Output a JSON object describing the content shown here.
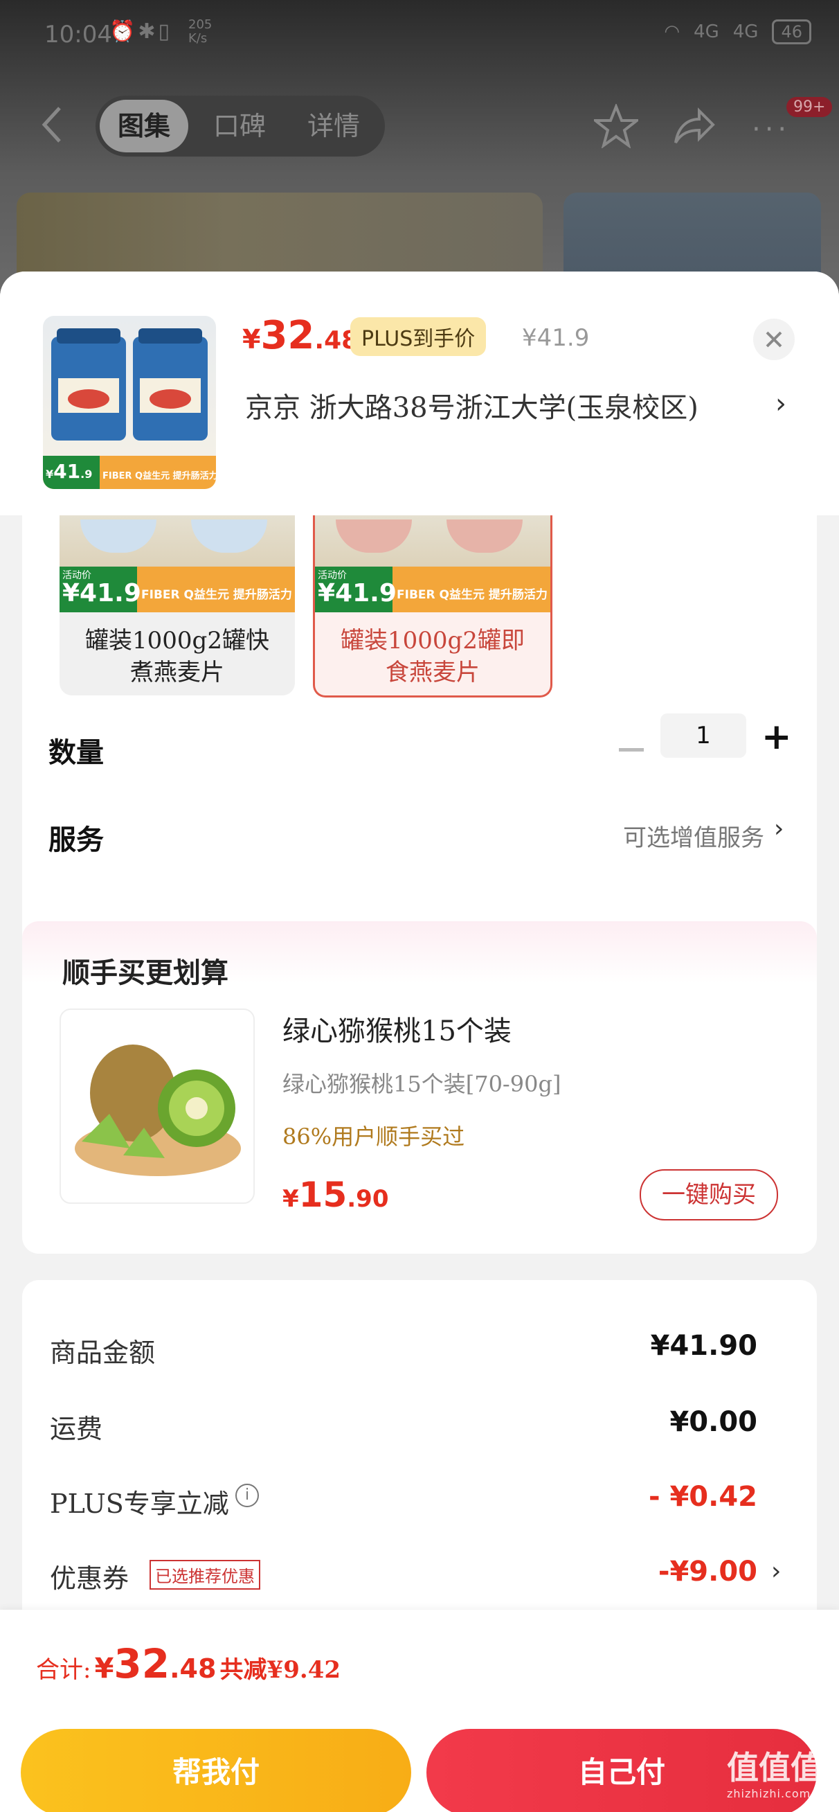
{
  "status_bar": {
    "time": "10:04",
    "speed": "205",
    "speed_unit": "K/s",
    "net1": "4G",
    "net2": "4G",
    "battery": "46"
  },
  "nav": {
    "tabs": [
      "图集",
      "口碑",
      "详情"
    ],
    "badge": "99+"
  },
  "product": {
    "price_yen": "¥",
    "price_int": "32",
    "price_dec": ".48",
    "plus_label": "PLUS到手价",
    "original_price": "¥41.9",
    "address": "京京   浙大路38号浙江大学(玉泉校区)",
    "thumb_price_yen": "¥",
    "thumb_price_int": "41",
    "thumb_price_dec": ".9",
    "thumb_strip_text": "FIBER Q益生元 提升肠活力"
  },
  "options": [
    {
      "label": "罐装1000g2罐快\n煮燕麦片",
      "badge": "活动价",
      "price": "¥41.9",
      "strip": "FIBER Q益生元 提升肠活力",
      "selected": false
    },
    {
      "label": "罐装1000g2罐即\n食燕麦片",
      "badge": "活动价",
      "price": "¥41.9",
      "strip": "FIBER Q益生元 提升肠活力",
      "selected": true
    }
  ],
  "quantity": {
    "label": "数量",
    "value": "1"
  },
  "service": {
    "label": "服务",
    "hint": "可选增值服务"
  },
  "bundle": {
    "title": "顺手买更划算",
    "name": "绿心猕猴桃15个装",
    "spec": "绿心猕猴桃15个装[70-90g]",
    "percent_text": "86%用户顺手买过",
    "price_yen": "¥",
    "price_int": "15",
    "price_dec": ".90",
    "button": "一键购买"
  },
  "summary": {
    "rows": [
      {
        "label": "商品金额",
        "value": "¥41.90"
      },
      {
        "label": "运费",
        "value": "¥0.00"
      },
      {
        "label": "PLUS专享立减",
        "value": "- ¥0.42"
      },
      {
        "label": "优惠券",
        "tag": "已选推荐优惠",
        "value": "-¥9.00"
      }
    ]
  },
  "footer": {
    "total_label": "合计:",
    "total_yen": "¥",
    "total_int": "32",
    "total_dec": ".48",
    "saving": "共减¥9.42",
    "btn_help": "帮我付",
    "btn_self": "自己付"
  },
  "watermark": {
    "big": "值值值",
    "small": "zhizhizhi.com"
  },
  "colors": {
    "accent_red": "#e62e1e",
    "button_yellow": "#fbc21e",
    "button_red": "#f23a4a",
    "plus_gold": "#fbe7a9"
  }
}
